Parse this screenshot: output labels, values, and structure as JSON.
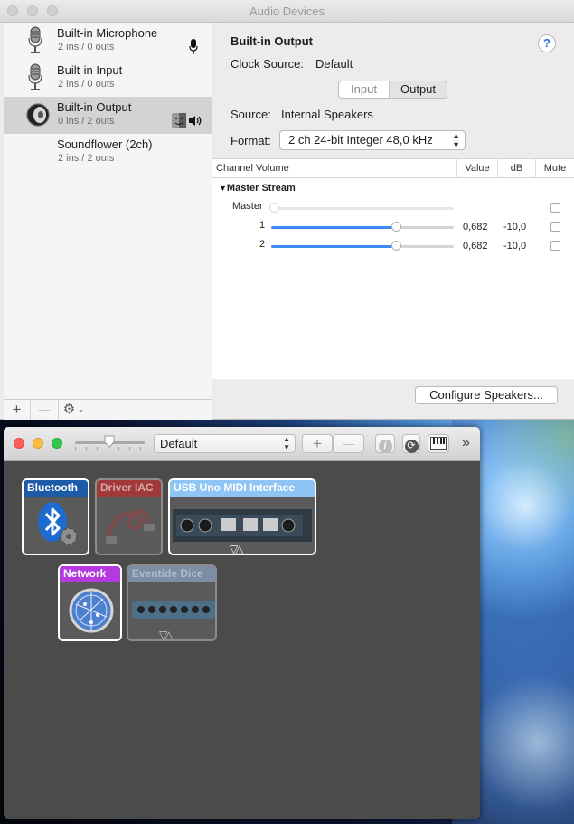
{
  "audio_window": {
    "title": "Audio Devices",
    "devices": [
      {
        "name": "Built-in Microphone",
        "io": "2 ins / 0 outs",
        "icon": "microphone-icon",
        "selected": false
      },
      {
        "name": "Built-in Input",
        "io": "2 ins / 0 outs",
        "icon": "microphone-icon",
        "selected": false
      },
      {
        "name": "Built-in Output",
        "io": "0 ins / 2 outs",
        "icon": "speaker-icon",
        "selected": true
      },
      {
        "name": "Soundflower (2ch)",
        "io": "2 ins / 2 outs",
        "icon": "",
        "selected": false
      }
    ],
    "sidebar_toolbar": {
      "add": "+",
      "remove": "—",
      "gear": "⚙"
    },
    "detail": {
      "device_title": "Built-in Output",
      "help": "?",
      "clock_source_label": "Clock Source:",
      "clock_source_value": "Default",
      "tabs": [
        "Input",
        "Output"
      ],
      "active_tab": "Output",
      "source_label": "Source:",
      "source_value": "Internal Speakers",
      "format_label": "Format:",
      "format_value": "2 ch 24-bit Integer 48,0 kHz",
      "table": {
        "headers": [
          "Channel Volume",
          "Value",
          "dB",
          "Mute"
        ],
        "group": "Master Stream",
        "rows": [
          {
            "label": "Master",
            "value": "",
            "db": "",
            "level": 0.0,
            "enabled": false,
            "muted": false
          },
          {
            "label": "1",
            "value": "0,682",
            "db": "-10,0",
            "level": 0.682,
            "enabled": true,
            "muted": false
          },
          {
            "label": "2",
            "value": "0,682",
            "db": "-10,0",
            "level": 0.682,
            "enabled": true,
            "muted": false
          }
        ]
      },
      "configure_button": "Configure Speakers..."
    }
  },
  "midi_window": {
    "configuration": "Default",
    "toolbar": {
      "add": "+",
      "remove": "—",
      "info": "i",
      "rescan": "⟳",
      "overflow": "»"
    },
    "devices": [
      {
        "name": "Bluetooth",
        "color": "#1d5ba8",
        "active": true
      },
      {
        "name": "Driver IAC",
        "color": "#a03a3a",
        "active": false
      },
      {
        "name": "USB Uno MIDI Interface",
        "color": "#8ec5f5",
        "active": true
      },
      {
        "name": "Network",
        "color": "#b43ae0",
        "active": true
      },
      {
        "name": "Eventide Dice",
        "color": "#7b8ea5",
        "active": false
      }
    ],
    "port_glyphs": "▽△"
  }
}
